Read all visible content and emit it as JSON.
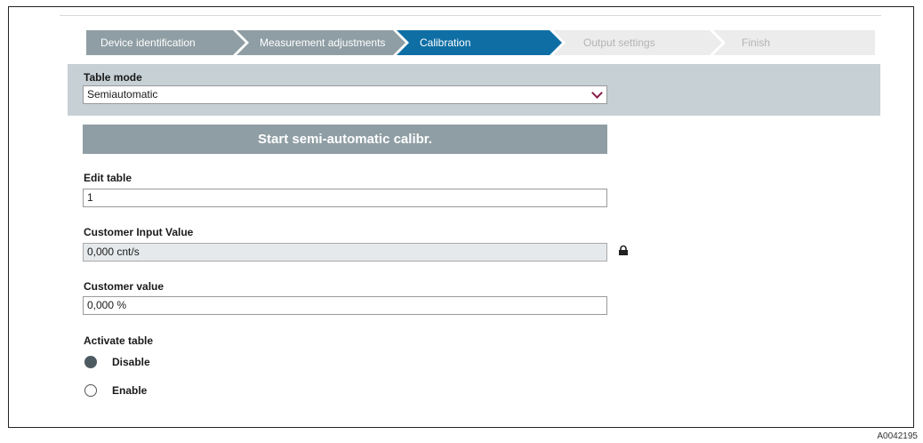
{
  "wizard": {
    "steps": [
      {
        "label": "Device identification",
        "state": "done"
      },
      {
        "label": "Measurement adjustments",
        "state": "done"
      },
      {
        "label": "Calibration",
        "state": "active"
      },
      {
        "label": "Output settings",
        "state": "todo"
      },
      {
        "label": "Finish",
        "state": "todo"
      }
    ]
  },
  "table_mode": {
    "label": "Table mode",
    "value": "Semiautomatic"
  },
  "start_button": {
    "label": "Start semi-automatic calibr."
  },
  "edit_table": {
    "label": "Edit table",
    "value": "1"
  },
  "customer_input_value": {
    "label": "Customer Input Value",
    "value": "0,000 cnt/s",
    "locked": true
  },
  "customer_value": {
    "label": "Customer value",
    "value": "0,000 %"
  },
  "activate_table": {
    "label": "Activate table",
    "options": [
      {
        "label": "Disable",
        "selected": true
      },
      {
        "label": "Enable",
        "selected": false
      }
    ]
  },
  "figure_code": "A0042195",
  "colors": {
    "active_step": "#0f6fa5",
    "done_step": "#8f9ea4",
    "band": "#c6d0d5",
    "chevron": "#8a1a4a"
  }
}
